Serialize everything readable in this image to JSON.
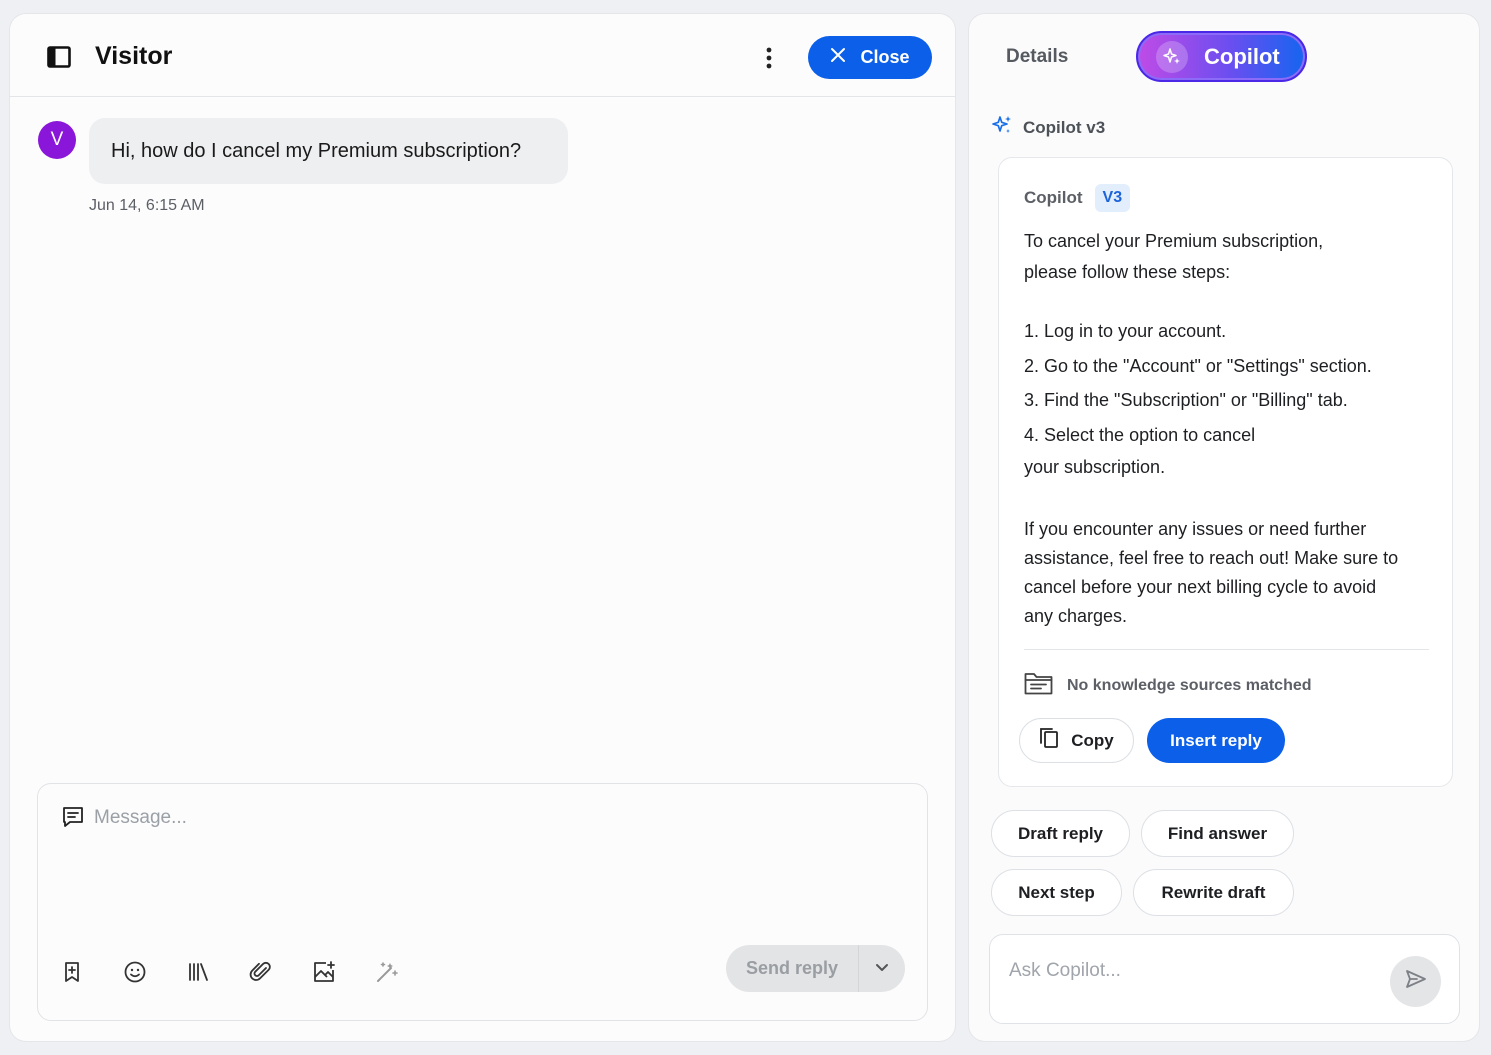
{
  "conversation": {
    "title": "Visitor",
    "close_label": "Close",
    "visitor_initial": "V",
    "message_text": "Hi, how do I cancel my Premium subscription?",
    "message_time": "Jun 14, 6:15 AM"
  },
  "composer": {
    "placeholder": "Message...",
    "send_label": "Send reply",
    "toolbar_icons": [
      "bookmark-plus-icon",
      "emoji-icon",
      "library-icon",
      "paperclip-icon",
      "image-add-icon",
      "magic-wand-icon"
    ]
  },
  "right_panel": {
    "tabs": [
      {
        "label": "Details",
        "active": false
      },
      {
        "label": "Copilot",
        "active": true
      }
    ],
    "version_label": "Copilot v3",
    "card": {
      "label": "Copilot",
      "badge": "V3",
      "intro_line1": "To cancel your Premium subscription,",
      "intro_line2": "please follow these steps:",
      "steps": [
        "1. Log in to your account.",
        "2. Go to the \"Account\" or \"Settings\" section.",
        "3. Find the \"Subscription\" or \"Billing\" tab.",
        "4. Select the option to cancel",
        "your subscription."
      ],
      "outro": [
        "If you encounter any issues or need further",
        "assistance, feel free to reach out! Make sure to",
        "cancel before your next billing cycle to avoid",
        "any charges."
      ],
      "knowledge_status": "No knowledge sources matched",
      "copy_label": "Copy",
      "insert_label": "Insert reply"
    },
    "chips": [
      "Draft reply",
      "Find answer",
      "Next step",
      "Rewrite draft"
    ],
    "ask_placeholder": "Ask Copilot..."
  },
  "colors": {
    "primary": "#0b5fe8",
    "avatar": "#8a16d9",
    "badge_bg": "#e3eefc"
  }
}
